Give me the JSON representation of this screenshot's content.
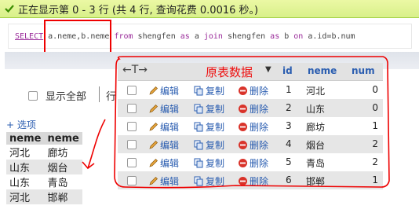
{
  "status": {
    "message": "正在显示第 0 - 3 行 (共 4 行, 查询花费 0.0016 秒。)"
  },
  "sql": {
    "select": "SELECT",
    "fields": " a.neme,b.neme ",
    "from": "from",
    "t1": " shengfen ",
    "as1": "as",
    "alias1": " a ",
    "join": "join",
    "t2": " shengfen ",
    "as2": "as",
    "alias2": " b ",
    "on": "on",
    "cond": " a.id=b.num"
  },
  "controls": {
    "show_all_label": "显示全部",
    "row_char": "行"
  },
  "left_panel": {
    "options_label": "+ 选项",
    "headers": [
      "neme",
      "neme"
    ],
    "rows": [
      [
        "河北",
        "廊坊"
      ],
      [
        "山东",
        "烟台"
      ],
      [
        "山东",
        "青岛"
      ],
      [
        "河北",
        "邯郸"
      ]
    ]
  },
  "main_table": {
    "nav_arrows": "←T→",
    "annotation": "原表数据",
    "sort_symbol": "▼",
    "headers": {
      "id": "id",
      "neme": "neme",
      "num": "num"
    },
    "actions": {
      "edit": "编辑",
      "copy": "复制",
      "delete": "删除"
    },
    "rows": [
      {
        "id": "1",
        "neme": "河北",
        "num": "0"
      },
      {
        "id": "2",
        "neme": "山东",
        "num": "0"
      },
      {
        "id": "3",
        "neme": "廊坊",
        "num": "1"
      },
      {
        "id": "4",
        "neme": "烟台",
        "num": "2"
      },
      {
        "id": "5",
        "neme": "青岛",
        "num": "2"
      },
      {
        "id": "6",
        "neme": "邯郸",
        "num": "1"
      }
    ]
  },
  "colors": {
    "success_bg": "#d8f08a",
    "link": "#2a5db0",
    "annotation_red": "#e00000",
    "keyword": "#9a2b9a"
  }
}
